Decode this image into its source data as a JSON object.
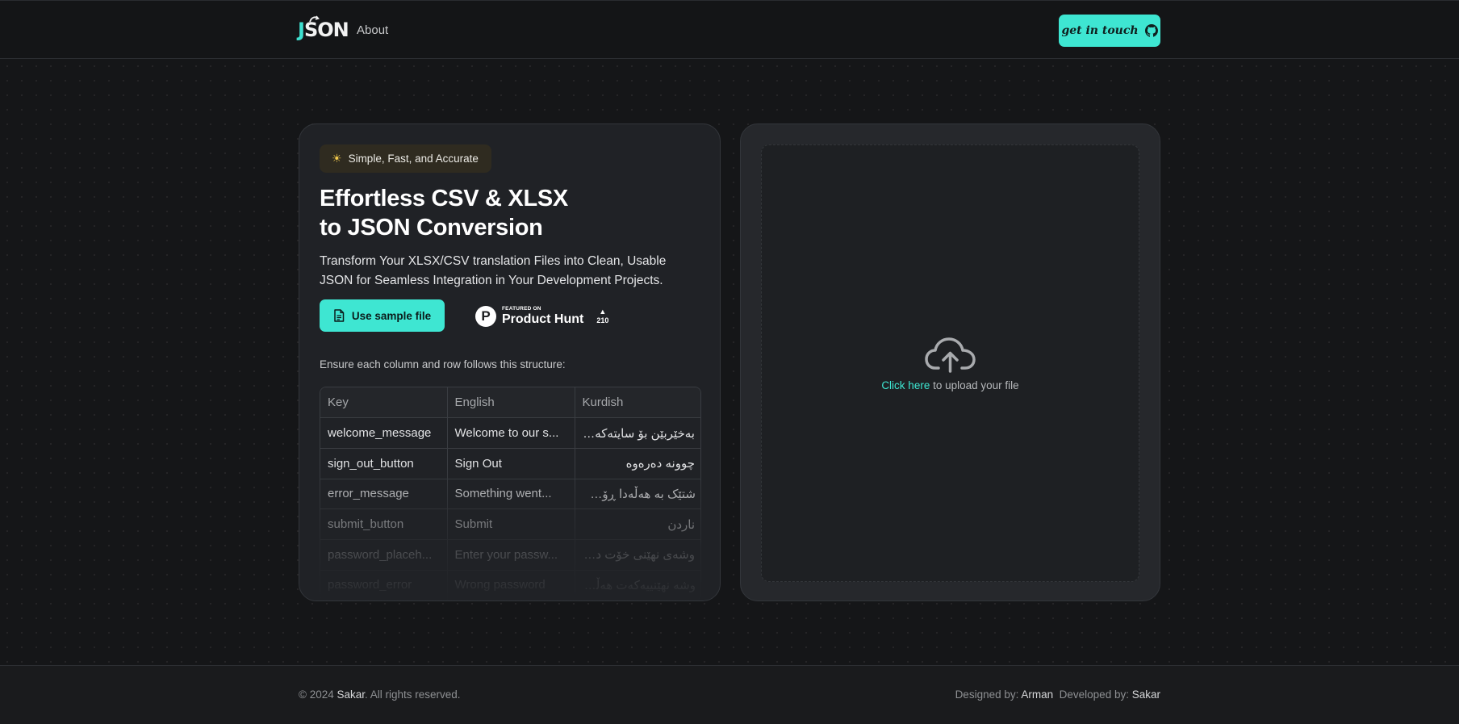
{
  "header": {
    "logo": {
      "j": "J",
      "rest": "SON"
    },
    "nav_about": "About",
    "cta_label": "get in touch",
    "cta_icon": "github-icon"
  },
  "hero": {
    "badge_icon": "sparkle-sun-icon",
    "badge": "Simple, Fast, and Accurate",
    "title_line1": "Effortless CSV & XLSX",
    "title_line2": "to JSON Conversion",
    "subtitle": "Transform Your XLSX/CSV translation Files into Clean, Usable JSON for Seamless Integration in Your Development Projects.",
    "sample_button": "Use sample file",
    "product_hunt": {
      "logo_letter": "P",
      "featured": "FEATURED ON",
      "name": "Product Hunt",
      "arrow": "▲",
      "votes": "210"
    },
    "structure_note": "Ensure each column and row follows this structure:"
  },
  "sample_table": {
    "headers": [
      "Key",
      "English",
      "Kurdish"
    ],
    "rows": [
      [
        "welcome_message",
        "Welcome to our s...",
        "بەخێربێن بۆ سایتەکەمان"
      ],
      [
        "sign_out_button",
        "Sign Out",
        "چوونە دەرەوە"
      ],
      [
        "error_message",
        "Something went...",
        "شتێک بە هەڵەدا ڕۆشت"
      ],
      [
        "submit_button",
        "Submit",
        "ناردن"
      ],
      [
        "password_placeh...",
        "Enter your passw...",
        "وشەی نهێنی خۆت داخڵ ب..."
      ],
      [
        "password_error",
        "Wrong password",
        "وشە نهێنییەکەت هەڵەیە"
      ]
    ]
  },
  "upload": {
    "icon": "cloud-upload-icon",
    "link_text": "Click here",
    "rest_text": " to upload your file"
  },
  "footer": {
    "copy_prefix": "© 2024 ",
    "copy_name": "Sakar",
    "copy_suffix": ". All rights reserved.",
    "designed_label": "Designed by: ",
    "designed_name": "Arman",
    "developed_label": "Developed by: ",
    "developed_name": "Sakar"
  },
  "colors": {
    "accent": "#3ee6d2",
    "background": "#141517",
    "card": "#202226"
  }
}
